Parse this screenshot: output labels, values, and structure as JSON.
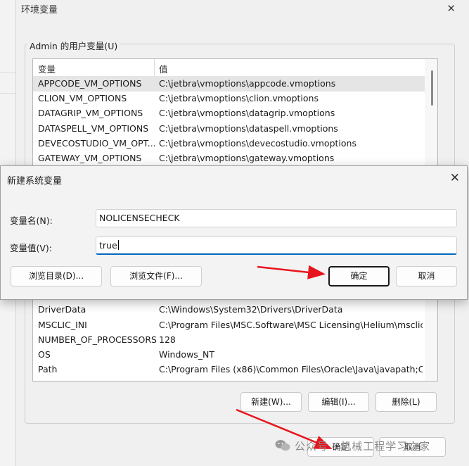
{
  "outer_window": {
    "title": "环境变量",
    "close_glyph": "✕",
    "user_group_label": "Admin 的用户变量(U)",
    "columns": {
      "variable": "变量",
      "value": "值"
    },
    "user_rows": [
      {
        "name": "APPCODE_VM_OPTIONS",
        "value": "C:\\jetbra\\vmoptions\\appcode.vmoptions"
      },
      {
        "name": "CLION_VM_OPTIONS",
        "value": "C:\\jetbra\\vmoptions\\clion.vmoptions"
      },
      {
        "name": "DATAGRIP_VM_OPTIONS",
        "value": "C:\\jetbra\\vmoptions\\datagrip.vmoptions"
      },
      {
        "name": "DATASPELL_VM_OPTIONS",
        "value": "C:\\jetbra\\vmoptions\\dataspell.vmoptions"
      },
      {
        "name": "DEVECOSTUDIO_VM_OPT...",
        "value": "C:\\jetbra\\vmoptions\\devecostudio.vmoptions"
      },
      {
        "name": "GATEWAY_VM_OPTIONS",
        "value": "C:\\jetbra\\vmoptions\\gateway.vmoptions"
      }
    ],
    "system_rows": [
      {
        "name": "DriverData",
        "value": "C:\\Windows\\System32\\Drivers\\DriverData"
      },
      {
        "name": "MSCLIC_INI",
        "value": "C:\\Program Files\\MSC.Software\\MSC Licensing\\Helium\\msclic..."
      },
      {
        "name": "NUMBER_OF_PROCESSORS",
        "value": "128"
      },
      {
        "name": "OS",
        "value": "Windows_NT"
      },
      {
        "name": "Path",
        "value": "C:\\Program Files (x86)\\Common Files\\Oracle\\Java\\javapath;C:..."
      }
    ],
    "system_buttons": {
      "new": "新建(W)...",
      "edit": "编辑(I)...",
      "delete": "删除(L)"
    },
    "footer_buttons": {
      "ok": "确定",
      "cancel": "取消"
    }
  },
  "dialog": {
    "title": "新建系统变量",
    "close_glyph": "✕",
    "name_label": "变量名(N):",
    "name_value": "NOLICENSECHECK",
    "value_label": "变量值(V):",
    "value_value": "true",
    "browse_dir": "浏览目录(D)...",
    "browse_file": "浏览文件(F)...",
    "ok": "确定",
    "cancel": "取消"
  },
  "watermark": {
    "text": "公众号 · 机械工程学习之家",
    "icon": "wechat-icon"
  },
  "colors": {
    "annotation_arrow": "#e8141b",
    "focus_accent": "#0067c0"
  }
}
